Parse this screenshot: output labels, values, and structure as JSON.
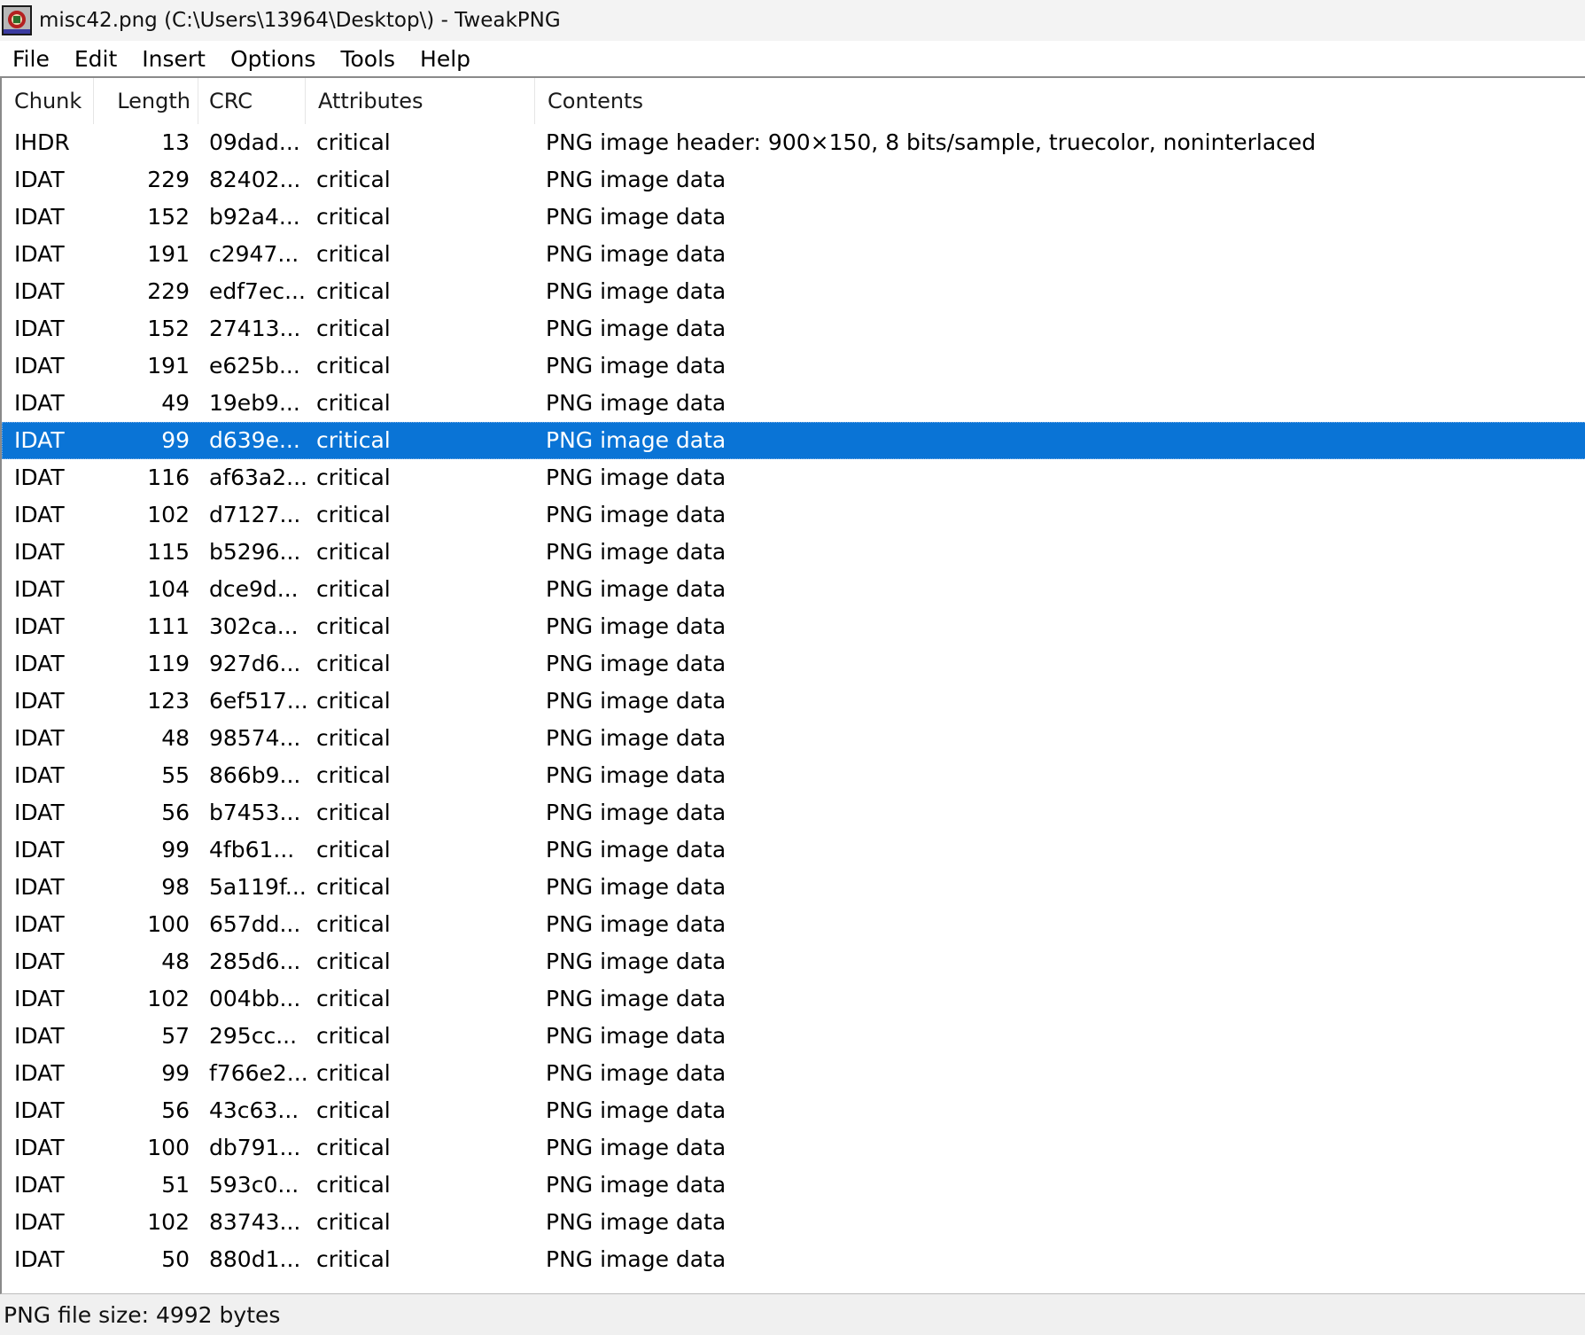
{
  "window": {
    "title": "misc42.png (C:\\Users\\13964\\Desktop\\) - TweakPNG"
  },
  "menu": [
    {
      "name": "menu-file",
      "label": "File"
    },
    {
      "name": "menu-edit",
      "label": "Edit"
    },
    {
      "name": "menu-insert",
      "label": "Insert"
    },
    {
      "name": "menu-options",
      "label": "Options"
    },
    {
      "name": "menu-tools",
      "label": "Tools"
    },
    {
      "name": "menu-help",
      "label": "Help"
    }
  ],
  "columns": {
    "chunk": "Chunk",
    "length": "Length",
    "crc": "CRC",
    "attributes": "Attributes",
    "contents": "Contents"
  },
  "rows": [
    {
      "chunk": "IHDR",
      "length": "13",
      "crc": "09dad...",
      "attr": "critical",
      "contents": "PNG image header: 900×150, 8 bits/sample, truecolor, noninterlaced"
    },
    {
      "chunk": "IDAT",
      "length": "229",
      "crc": "82402...",
      "attr": "critical",
      "contents": "PNG image data"
    },
    {
      "chunk": "IDAT",
      "length": "152",
      "crc": "b92a4...",
      "attr": "critical",
      "contents": "PNG image data"
    },
    {
      "chunk": "IDAT",
      "length": "191",
      "crc": "c2947...",
      "attr": "critical",
      "contents": "PNG image data"
    },
    {
      "chunk": "IDAT",
      "length": "229",
      "crc": "edf7ec...",
      "attr": "critical",
      "contents": "PNG image data"
    },
    {
      "chunk": "IDAT",
      "length": "152",
      "crc": "27413...",
      "attr": "critical",
      "contents": "PNG image data"
    },
    {
      "chunk": "IDAT",
      "length": "191",
      "crc": "e625b...",
      "attr": "critical",
      "contents": "PNG image data"
    },
    {
      "chunk": "IDAT",
      "length": "49",
      "crc": "19eb9...",
      "attr": "critical",
      "contents": "PNG image data"
    },
    {
      "chunk": "IDAT",
      "length": "99",
      "crc": "d639e...",
      "attr": "critical",
      "contents": "PNG image data",
      "selected": true
    },
    {
      "chunk": "IDAT",
      "length": "116",
      "crc": "af63a2...",
      "attr": "critical",
      "contents": "PNG image data"
    },
    {
      "chunk": "IDAT",
      "length": "102",
      "crc": "d7127...",
      "attr": "critical",
      "contents": "PNG image data"
    },
    {
      "chunk": "IDAT",
      "length": "115",
      "crc": "b5296...",
      "attr": "critical",
      "contents": "PNG image data"
    },
    {
      "chunk": "IDAT",
      "length": "104",
      "crc": "dce9d...",
      "attr": "critical",
      "contents": "PNG image data"
    },
    {
      "chunk": "IDAT",
      "length": "111",
      "crc": "302ca...",
      "attr": "critical",
      "contents": "PNG image data"
    },
    {
      "chunk": "IDAT",
      "length": "119",
      "crc": "927d6...",
      "attr": "critical",
      "contents": "PNG image data"
    },
    {
      "chunk": "IDAT",
      "length": "123",
      "crc": "6ef517...",
      "attr": "critical",
      "contents": "PNG image data"
    },
    {
      "chunk": "IDAT",
      "length": "48",
      "crc": "98574...",
      "attr": "critical",
      "contents": "PNG image data"
    },
    {
      "chunk": "IDAT",
      "length": "55",
      "crc": "866b9...",
      "attr": "critical",
      "contents": "PNG image data"
    },
    {
      "chunk": "IDAT",
      "length": "56",
      "crc": "b7453...",
      "attr": "critical",
      "contents": "PNG image data"
    },
    {
      "chunk": "IDAT",
      "length": "99",
      "crc": "4fb61...",
      "attr": "critical",
      "contents": "PNG image data"
    },
    {
      "chunk": "IDAT",
      "length": "98",
      "crc": "5a119f...",
      "attr": "critical",
      "contents": "PNG image data"
    },
    {
      "chunk": "IDAT",
      "length": "100",
      "crc": "657dd...",
      "attr": "critical",
      "contents": "PNG image data"
    },
    {
      "chunk": "IDAT",
      "length": "48",
      "crc": "285d6...",
      "attr": "critical",
      "contents": "PNG image data"
    },
    {
      "chunk": "IDAT",
      "length": "102",
      "crc": "004bb...",
      "attr": "critical",
      "contents": "PNG image data"
    },
    {
      "chunk": "IDAT",
      "length": "57",
      "crc": "295cc...",
      "attr": "critical",
      "contents": "PNG image data"
    },
    {
      "chunk": "IDAT",
      "length": "99",
      "crc": "f766e2...",
      "attr": "critical",
      "contents": "PNG image data"
    },
    {
      "chunk": "IDAT",
      "length": "56",
      "crc": "43c63...",
      "attr": "critical",
      "contents": "PNG image data"
    },
    {
      "chunk": "IDAT",
      "length": "100",
      "crc": "db791...",
      "attr": "critical",
      "contents": "PNG image data"
    },
    {
      "chunk": "IDAT",
      "length": "51",
      "crc": "593c0...",
      "attr": "critical",
      "contents": "PNG image data"
    },
    {
      "chunk": "IDAT",
      "length": "102",
      "crc": "83743...",
      "attr": "critical",
      "contents": "PNG image data"
    },
    {
      "chunk": "IDAT",
      "length": "50",
      "crc": "880d1...",
      "attr": "critical",
      "contents": "PNG image data"
    }
  ],
  "status": {
    "text": "PNG file size: 4992 bytes"
  }
}
